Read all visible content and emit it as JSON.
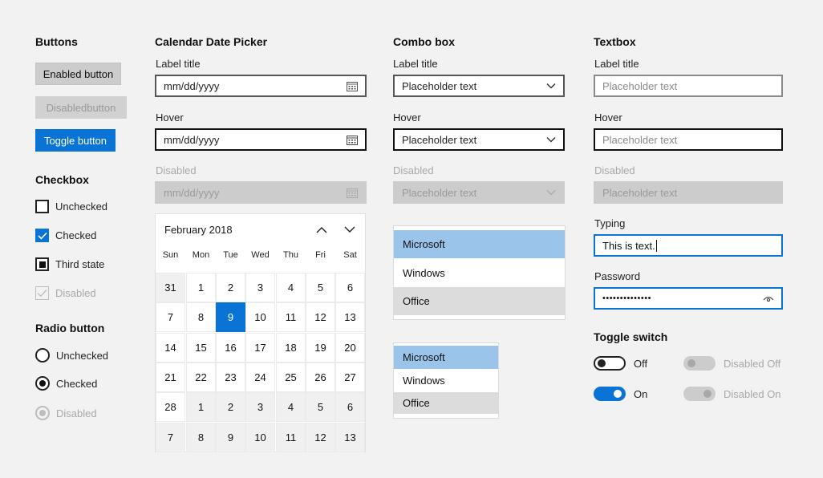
{
  "buttons": {
    "heading": "Buttons",
    "enabled": "Enabled button",
    "disabled": "Disabledbutton",
    "toggle": "Toggle button"
  },
  "checkbox": {
    "heading": "Checkbox",
    "unchecked": "Unchecked",
    "checked": "Checked",
    "third": "Third state",
    "disabled": "Disabled"
  },
  "radio": {
    "heading": "Radio button",
    "unchecked": "Unchecked",
    "checked": "Checked",
    "disabled": "Disabled"
  },
  "calendar": {
    "heading": "Calendar Date Picker",
    "label_title": "Label title",
    "label_hover": "Hover",
    "label_disabled": "Disabled",
    "value": "mm/dd/yyyy",
    "month": "February 2018",
    "weekdays": [
      "Sun",
      "Mon",
      "Tue",
      "Wed",
      "Thu",
      "Fri",
      "Sat"
    ],
    "weeks": [
      [
        "31",
        "1",
        "2",
        "3",
        "4",
        "5",
        "6"
      ],
      [
        "7",
        "8",
        "9",
        "10",
        "11",
        "12",
        "13"
      ],
      [
        "14",
        "15",
        "16",
        "17",
        "18",
        "19",
        "20"
      ],
      [
        "21",
        "22",
        "23",
        "24",
        "25",
        "26",
        "27"
      ],
      [
        "28",
        "1",
        "2",
        "3",
        "4",
        "5",
        "6"
      ],
      [
        "7",
        "8",
        "9",
        "10",
        "11",
        "12",
        "13"
      ]
    ],
    "selected_day": "9"
  },
  "combo": {
    "heading": "Combo box",
    "label_title": "Label title",
    "label_hover": "Hover",
    "label_disabled": "Disabled",
    "placeholder": "Placeholder text",
    "list1": [
      "Microsoft",
      "Windows",
      "Office"
    ],
    "list2": [
      "Microsoft",
      "Windows",
      "Office"
    ]
  },
  "textbox": {
    "heading": "Textbox",
    "label_title": "Label title",
    "label_hover": "Hover",
    "label_disabled": "Disabled",
    "label_typing": "Typing",
    "label_password": "Password",
    "placeholder": "Placeholder text",
    "typing_value": "This is text.",
    "password_value": "••••••••••••••"
  },
  "toggle": {
    "heading": "Toggle switch",
    "off": "Off",
    "on": "On",
    "disabled_off": "Disabled Off",
    "disabled_on": "Disabled On"
  },
  "colors": {
    "accent": "#0a74d6",
    "list_selected": "#9bc4ea",
    "list_hover": "#dcdcdc",
    "background": "#f2f2f2"
  }
}
